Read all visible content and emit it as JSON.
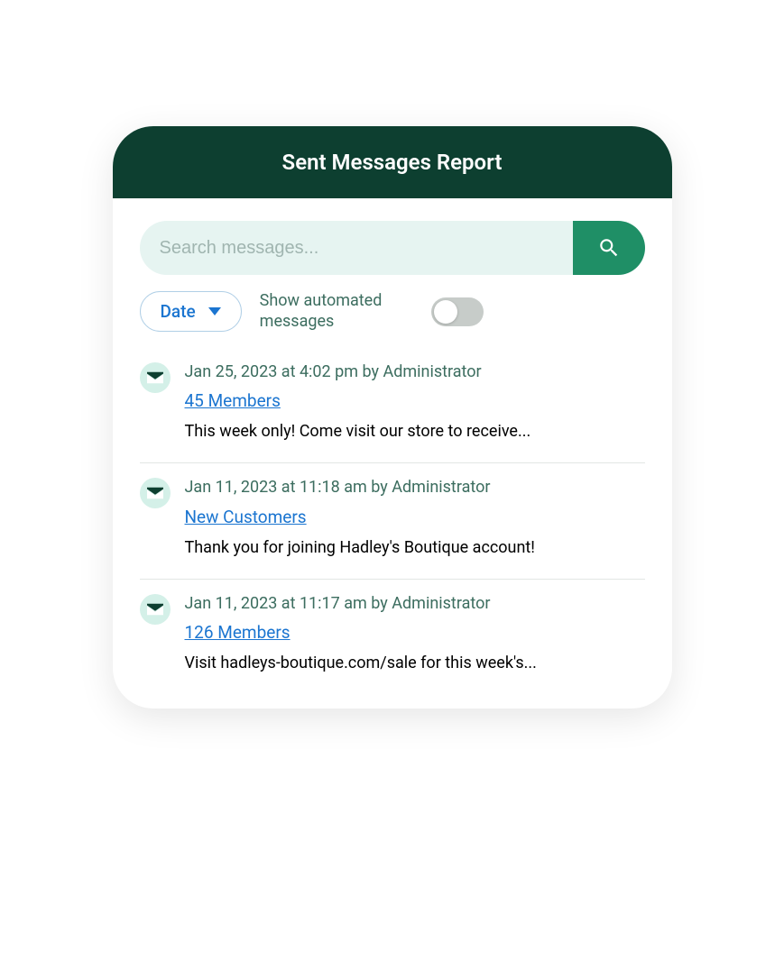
{
  "header": {
    "title": "Sent Messages Report"
  },
  "search": {
    "placeholder": "Search messages..."
  },
  "filters": {
    "date_label": "Date",
    "toggle_label": "Show automated messages"
  },
  "messages": [
    {
      "timestamp": "Jan 25, 2023 at 4:02 pm by Administrator",
      "recipients": "45 Members",
      "preview": "This week only! Come visit our store to receive..."
    },
    {
      "timestamp": "Jan 11, 2023 at 11:18 am by Administrator",
      "recipients": "New Customers",
      "preview": "Thank you for joining Hadley's Boutique account!"
    },
    {
      "timestamp": "Jan 11, 2023 at 11:17 am by Administrator",
      "recipients": "126 Members",
      "preview": "Visit hadleys-boutique.com/sale for this week's..."
    }
  ]
}
